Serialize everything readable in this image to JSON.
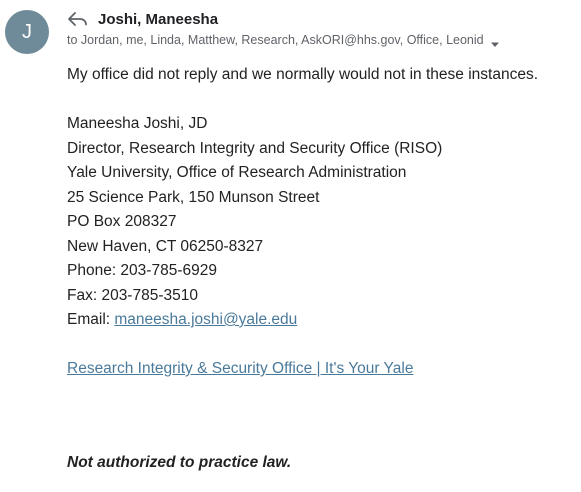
{
  "avatar": {
    "initial": "J",
    "color": "#6f8a99"
  },
  "header": {
    "sender": "Joshi, Maneesha",
    "recipients": "to Jordan, me, Linda, Matthew, Research, AskORI@hhs.gov, Office, Leonid",
    "icon_reply": "reply-arrow-icon",
    "icon_expand": "chevron-down-icon"
  },
  "message": {
    "intro": "My office did not reply and we normally would not in these instances.",
    "signature": {
      "name": "Maneesha Joshi, JD",
      "title": "Director, Research Integrity and Security Office (RISO)",
      "org": "Yale University, Office of Research Administration",
      "address1": "25 Science Park, 150 Munson Street",
      "address2": "PO Box 208327",
      "address3": "New Haven, CT 06250-8327",
      "phone": "Phone: 203-785-6929",
      "fax": "Fax: 203-785-3510",
      "email_label": "Email: ",
      "email": "maneesha.joshi@yale.edu"
    },
    "link_text": "Research Integrity & Security Office | It's Your Yale",
    "disclaimer": "Not authorized to practice law."
  },
  "colors": {
    "link": "#4a7a9b",
    "text": "#222222",
    "muted": "#5f6368"
  }
}
